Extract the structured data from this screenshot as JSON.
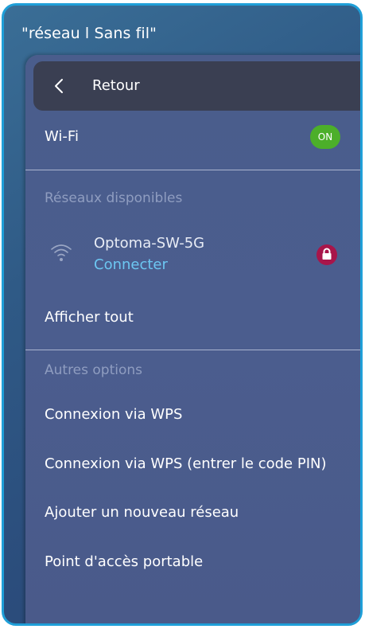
{
  "page": {
    "title": "\"réseau l Sans fil\""
  },
  "header": {
    "back_label": "Retour",
    "back_icon": "chevron-left-icon"
  },
  "wifi": {
    "label": "Wi-Fi",
    "toggle_label": "ON",
    "toggle_color": "#4caf2a"
  },
  "available_networks": {
    "section_label": "Réseaux disponibles",
    "networks": [
      {
        "name": "Optoma-SW-5G",
        "status": "Connecter",
        "signal_icon": "wifi-icon",
        "secured_icon": "lock-icon",
        "lock_color": "#a8154a"
      }
    ],
    "show_all_label": "Afficher tout"
  },
  "other_options": {
    "section_label": "Autres options",
    "items": [
      {
        "label": "Connexion via WPS"
      },
      {
        "label": "Connexion via WPS (entrer le code PIN)"
      },
      {
        "label": "Ajouter un nouveau réseau"
      },
      {
        "label": "Point d'accès portable"
      }
    ]
  },
  "colors": {
    "frame_border": "#1f9fd8",
    "panel_bg": "#4a5d8c",
    "back_bar_bg": "#3a3f52",
    "status_link": "#6cc7f2",
    "section_label": "#8f9dc0"
  }
}
